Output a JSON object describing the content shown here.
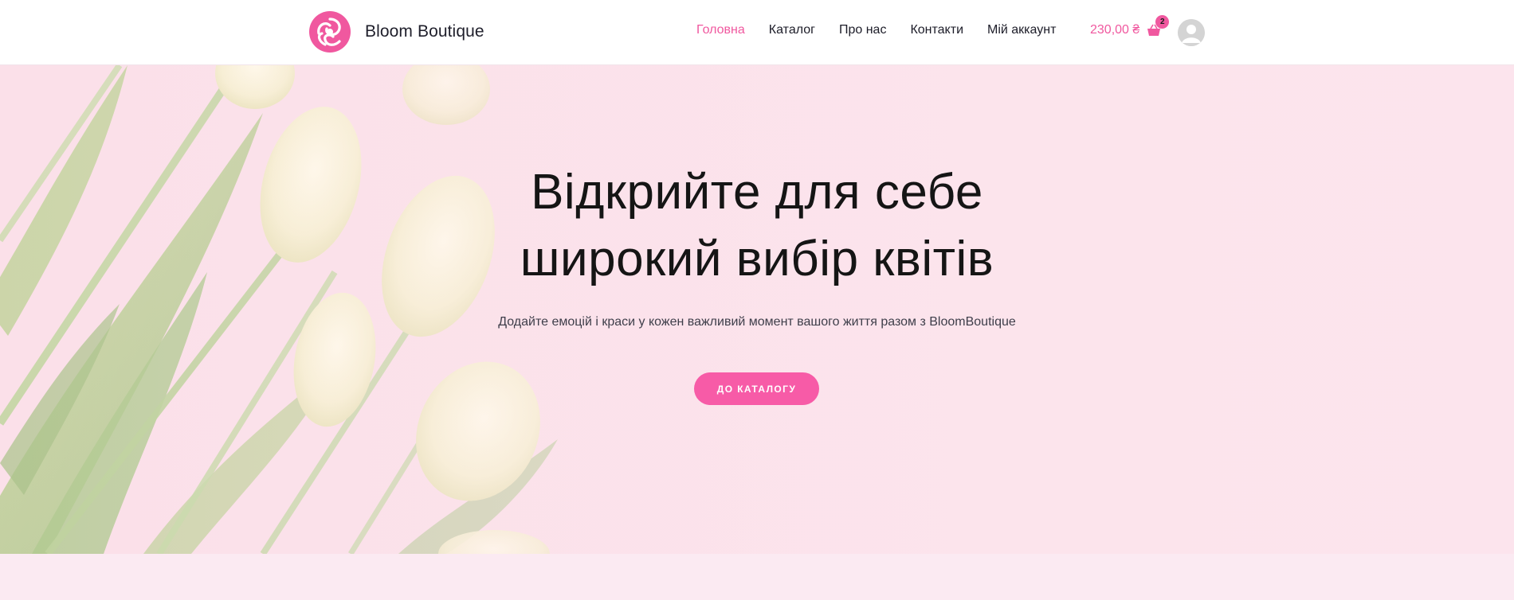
{
  "header": {
    "brand": "Bloom Boutique",
    "nav": [
      {
        "label": "Головна",
        "active": true
      },
      {
        "label": "Каталог",
        "active": false
      },
      {
        "label": "Про нас",
        "active": false
      },
      {
        "label": "Контакти",
        "active": false
      },
      {
        "label": "Мій аккаунт",
        "active": false
      }
    ],
    "cart": {
      "total": "230,00 ₴",
      "count": "2",
      "icon": "basket-icon"
    },
    "account_icon": "user-avatar-icon"
  },
  "hero": {
    "title_line1": "Відкрийте для себе",
    "title_line2": "широкий вибір квітів",
    "subtitle": "Додайте емоцій і краси у кожен важливий момент вашого життя разом з BloomBoutique",
    "button": "ДО КАТАЛОГУ",
    "background_image": "white tulips on pink background"
  },
  "colors": {
    "accent": "#f0589f",
    "button": "#f75ba7",
    "hero_bg": "#fbdfe8",
    "text": "#151515"
  }
}
